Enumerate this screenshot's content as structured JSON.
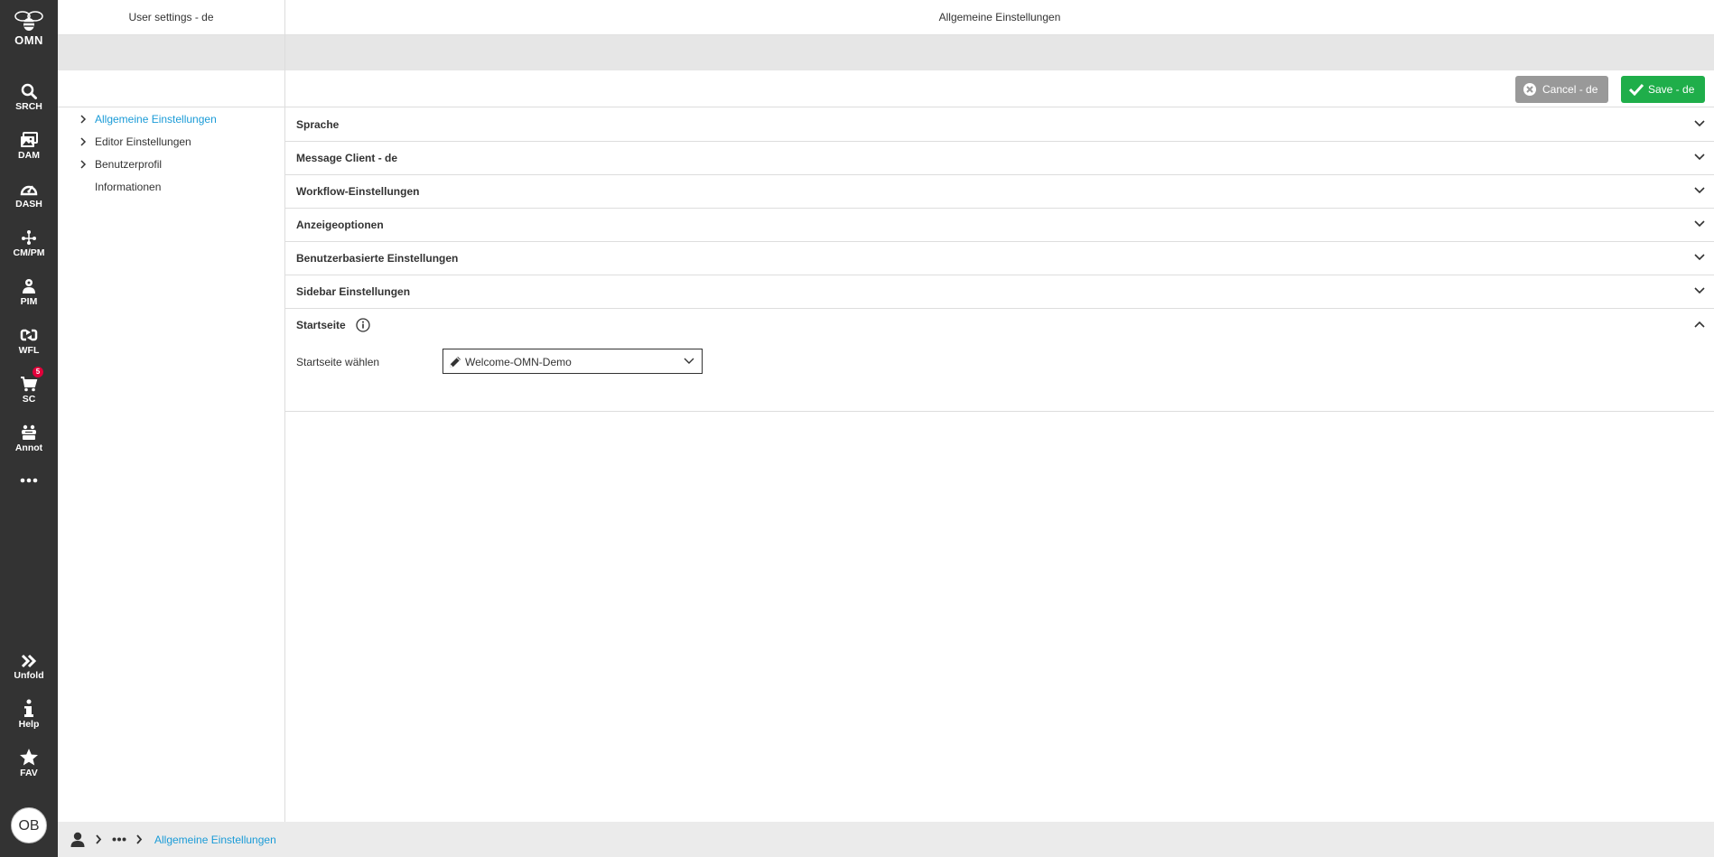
{
  "rail": {
    "logo_text": "OMN",
    "items": [
      {
        "label": "SRCH",
        "icon": "search-icon"
      },
      {
        "label": "DAM",
        "icon": "images-icon"
      },
      {
        "label": "DASH",
        "icon": "dashboard-icon"
      },
      {
        "label": "CM/PM",
        "icon": "network-icon"
      },
      {
        "label": "PIM",
        "icon": "pim-icon"
      },
      {
        "label": "WFL",
        "icon": "workflow-icon"
      },
      {
        "label": "SC",
        "icon": "cart-icon",
        "badge": "5"
      },
      {
        "label": "Annot",
        "icon": "annotation-icon"
      }
    ],
    "more_icon": "more-icon",
    "bottom": [
      {
        "label": "Unfold",
        "icon": "unfold-icon"
      },
      {
        "label": "Help",
        "icon": "info-icon"
      },
      {
        "label": "FAV",
        "icon": "star-icon"
      }
    ],
    "avatar": "OB"
  },
  "left_panel": {
    "title": "User settings - de",
    "tree": [
      {
        "label": "Allgemeine Einstellungen",
        "active": true,
        "expandable": true
      },
      {
        "label": "Editor Einstellungen",
        "active": false,
        "expandable": true
      },
      {
        "label": "Benutzerprofil",
        "active": false,
        "expandable": true
      },
      {
        "label": "Informationen",
        "active": false,
        "expandable": false
      }
    ]
  },
  "main": {
    "title": "Allgemeine Einstellungen",
    "cancel_label": "Cancel - de",
    "save_label": "Save - de",
    "sections": [
      {
        "title": "Sprache",
        "expanded": false
      },
      {
        "title": "Message Client - de",
        "expanded": false
      },
      {
        "title": "Workflow-Einstellungen",
        "expanded": false
      },
      {
        "title": "Anzeigeoptionen",
        "expanded": false
      },
      {
        "title": "Benutzerbasierte Einstellungen",
        "expanded": false
      },
      {
        "title": "Sidebar Einstellungen",
        "expanded": false
      },
      {
        "title": "Startseite",
        "expanded": true
      }
    ],
    "startseite": {
      "field_label": "Startseite wählen",
      "selected": "Welcome-OMN-Demo"
    }
  },
  "footer": {
    "breadcrumb_current": "Allgemeine Einstellungen"
  },
  "colors": {
    "rail_bg": "#333333",
    "accent_link": "#1a9bd7",
    "save_green": "#1fae4a",
    "cancel_gray": "#999999",
    "badge_red": "#e2003b"
  }
}
